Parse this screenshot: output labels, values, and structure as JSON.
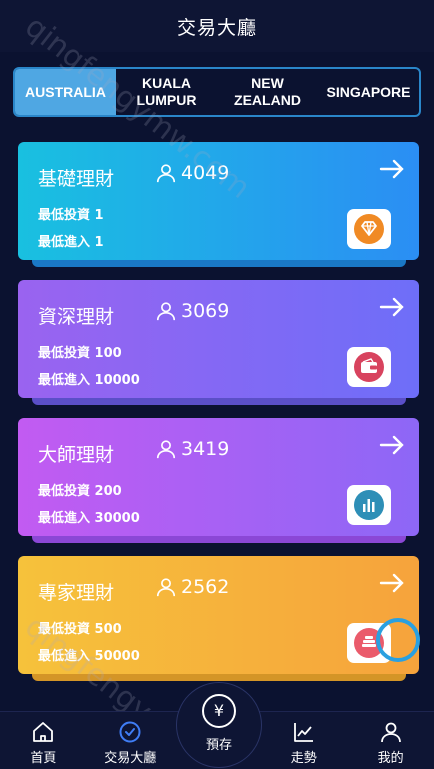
{
  "header": {
    "title": "交易大廳"
  },
  "tabs": [
    {
      "label": "AUSTRALIA",
      "active": true
    },
    {
      "label": "KUALA LUMPUR",
      "active": false
    },
    {
      "label": "NEW ZEALAND",
      "active": false
    },
    {
      "label": "SINGAPORE",
      "active": false
    }
  ],
  "cards": [
    {
      "name": "基礎理財",
      "count": "4049",
      "line1": "最低投資 1",
      "line2": "最低進入 1",
      "icon": "diamond-icon",
      "color": "#f08a24"
    },
    {
      "name": "資深理財",
      "count": "3069",
      "line1": "最低投資 100",
      "line2": "最低進入 10000",
      "icon": "wallet-icon",
      "color": "#d8435e"
    },
    {
      "name": "大師理財",
      "count": "3419",
      "line1": "最低投資 200",
      "line2": "最低進入 30000",
      "icon": "bar-chart-icon",
      "color": "#2e8fb7"
    },
    {
      "name": "專家理財",
      "count": "2562",
      "line1": "最低投資 500",
      "line2": "最低進入 50000",
      "icon": "coins-icon",
      "color": "#ea5b6b"
    }
  ],
  "nav": {
    "home": "首頁",
    "hall": "交易大廳",
    "deposit": "預存",
    "deposit_symbol": "¥",
    "trend": "走勢",
    "mine": "我的"
  },
  "watermark": "qingfengymw.com",
  "colors": {
    "active_tab": "#4fa7e3",
    "background": "#0b1230",
    "nav_active": "#3f7df5"
  }
}
